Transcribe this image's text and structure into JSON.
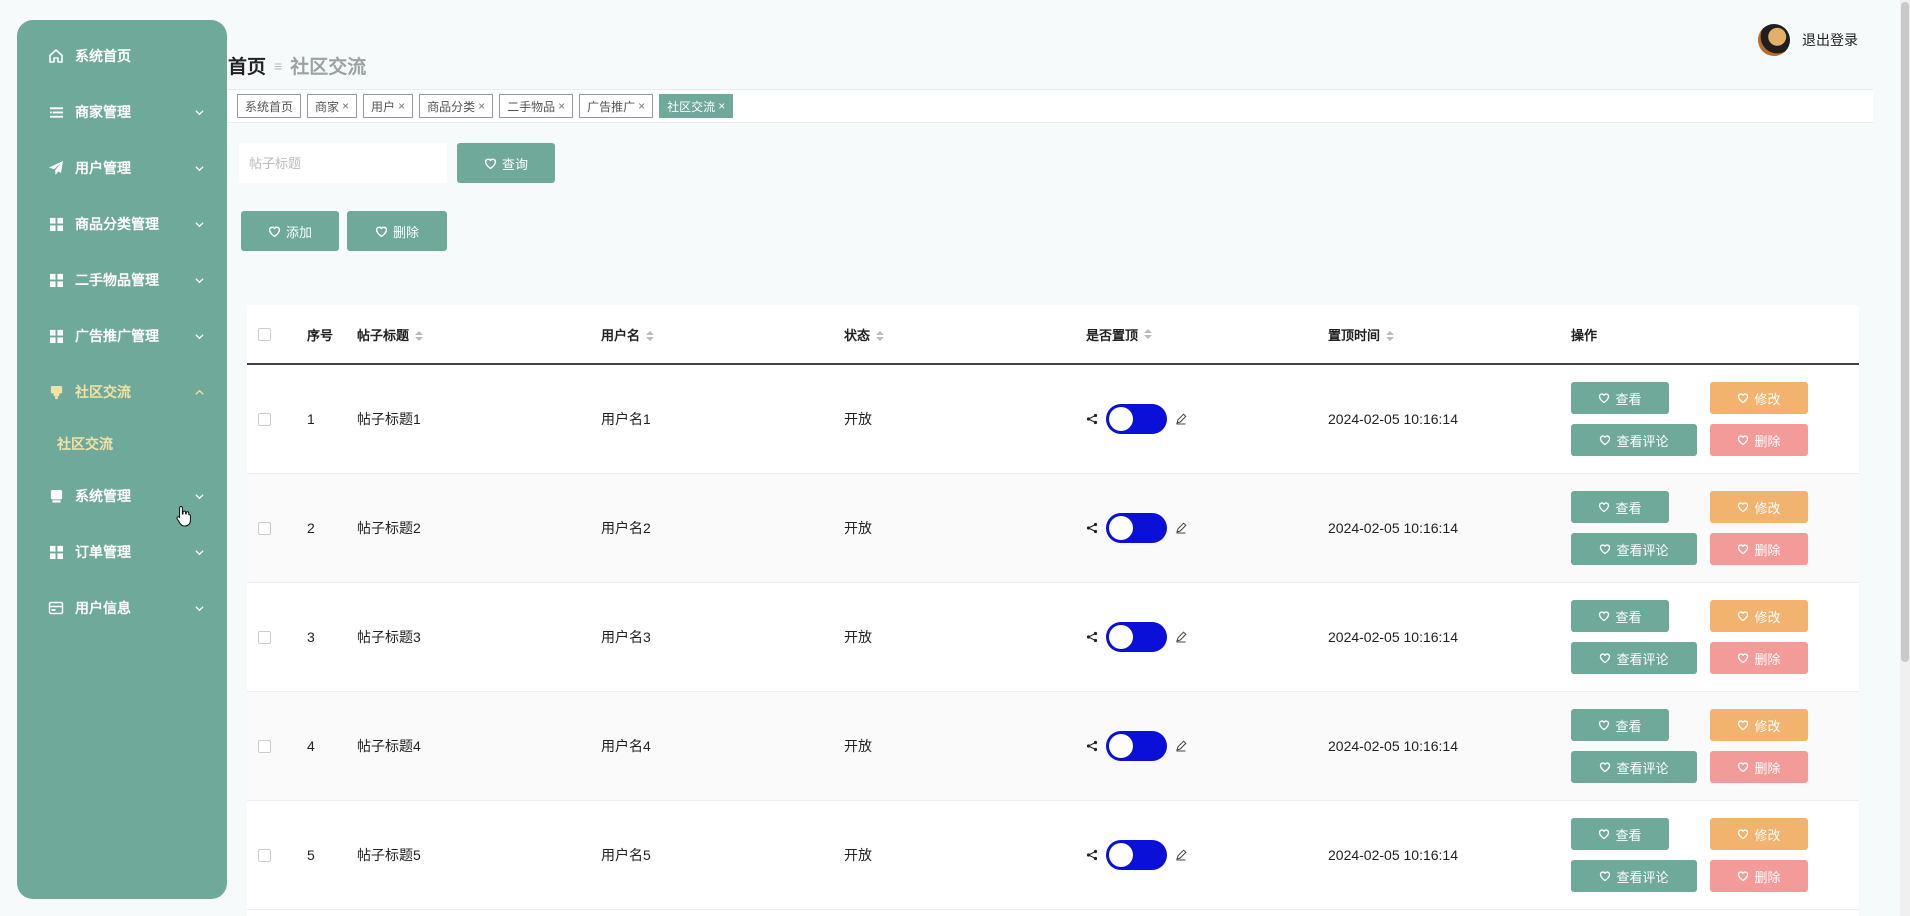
{
  "sidebar": {
    "items": [
      {
        "label": "系统首页",
        "icon": "home-icon",
        "chevron": false,
        "expanded": false
      },
      {
        "label": "商家管理",
        "icon": "list-icon",
        "chevron": true,
        "expanded": false
      },
      {
        "label": "用户管理",
        "icon": "send-icon",
        "chevron": true,
        "expanded": false
      },
      {
        "label": "商品分类管理",
        "icon": "grid-icon",
        "chevron": true,
        "expanded": false
      },
      {
        "label": "二手物品管理",
        "icon": "grid-icon",
        "chevron": true,
        "expanded": false
      },
      {
        "label": "广告推广管理",
        "icon": "grid-icon",
        "chevron": true,
        "expanded": false
      },
      {
        "label": "社区交流",
        "icon": "stand-icon",
        "chevron": true,
        "expanded": true
      },
      {
        "label": "系统管理",
        "icon": "monitor-icon",
        "chevron": true,
        "expanded": false
      },
      {
        "label": "订单管理",
        "icon": "grid-icon",
        "chevron": true,
        "expanded": false
      },
      {
        "label": "用户信息",
        "icon": "card-icon",
        "chevron": true,
        "expanded": false
      }
    ],
    "submenu": {
      "label": "社区交流"
    }
  },
  "header": {
    "breadcrumb_home": "首页",
    "breadcrumb_sep": "≡",
    "breadcrumb_current": "社区交流",
    "logout": "退出登录"
  },
  "tabs": [
    {
      "label": "系统首页",
      "closable": false,
      "active": false
    },
    {
      "label": "商家",
      "closable": true,
      "active": false
    },
    {
      "label": "用户",
      "closable": true,
      "active": false
    },
    {
      "label": "商品分类",
      "closable": true,
      "active": false
    },
    {
      "label": "二手物品",
      "closable": true,
      "active": false
    },
    {
      "label": "广告推广",
      "closable": true,
      "active": false
    },
    {
      "label": "社区交流",
      "closable": true,
      "active": true
    }
  ],
  "tab_close_glyph": "×",
  "search": {
    "placeholder": "帖子标题",
    "button": "查询"
  },
  "actions": {
    "add": "添加",
    "delete": "删除"
  },
  "table": {
    "headers": {
      "index": "序号",
      "title": "帖子标题",
      "username": "用户名",
      "status": "状态",
      "pinned": "是否置顶",
      "pin_time": "置顶时间",
      "ops": "操作"
    },
    "op_labels": {
      "view": "查看",
      "edit": "修改",
      "comments": "查看评论",
      "delete": "删除"
    },
    "rows": [
      {
        "index": "1",
        "title": "帖子标题1",
        "username": "用户名1",
        "status": "开放",
        "pinned": true,
        "pin_time": "2024-02-05 10:16:14"
      },
      {
        "index": "2",
        "title": "帖子标题2",
        "username": "用户名2",
        "status": "开放",
        "pinned": true,
        "pin_time": "2024-02-05 10:16:14"
      },
      {
        "index": "3",
        "title": "帖子标题3",
        "username": "用户名3",
        "status": "开放",
        "pinned": true,
        "pin_time": "2024-02-05 10:16:14"
      },
      {
        "index": "4",
        "title": "帖子标题4",
        "username": "用户名4",
        "status": "开放",
        "pinned": true,
        "pin_time": "2024-02-05 10:16:14"
      },
      {
        "index": "5",
        "title": "帖子标题5",
        "username": "用户名5",
        "status": "开放",
        "pinned": true,
        "pin_time": "2024-02-05 10:16:14"
      }
    ]
  },
  "colors": {
    "primary": "#6ea99a",
    "edit": "#f1b36e",
    "delete": "#f39b98",
    "switch_on": "#0b10d8",
    "active_menu": "#f3e2a6"
  }
}
